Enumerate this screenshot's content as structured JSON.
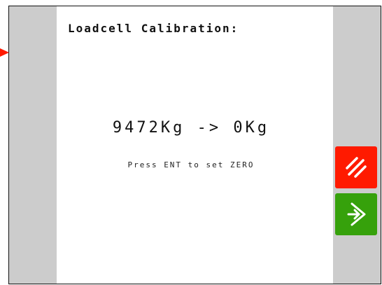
{
  "screen": {
    "title": "Loadcell Calibration:",
    "reading": "9472Kg -> 0Kg",
    "hint": "Press ENT to set ZERO"
  },
  "buttons": {
    "cancel_icon": "triple-slash-cancel-icon",
    "enter_icon": "enter-arrow-icon"
  },
  "colors": {
    "side_panel": "#cccccc",
    "cancel": "#ff1a00",
    "enter": "#36a10b",
    "pointer": "#ff1a00"
  }
}
